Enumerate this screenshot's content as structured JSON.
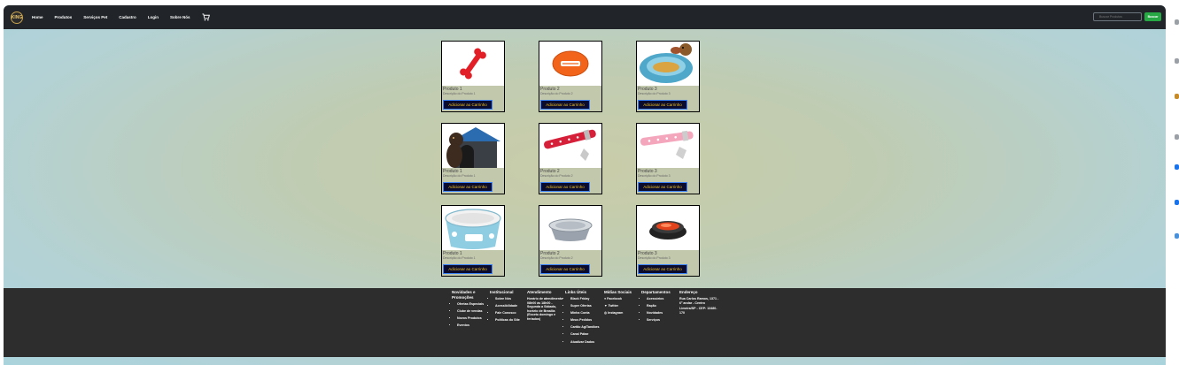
{
  "navbar": {
    "brand": "KING",
    "links": [
      "Home",
      "Produtos",
      "Serviços Pet",
      "Cadastro",
      "Login",
      "Sobre Nós"
    ],
    "search_placeholder": "Buscar Produtos",
    "search_button": "Buscar"
  },
  "products": [
    {
      "name": "Produto 1",
      "desc": "Descrição do Produto 1",
      "button": "Adicionar ao Carrinho",
      "image": "red-bone-toy"
    },
    {
      "name": "Produto 2",
      "desc": "Descrição do Produto 2",
      "button": "Adicionar ao Carrinho",
      "image": "orange-football-toy"
    },
    {
      "name": "Produto 3",
      "desc": "Descrição do Produto 3",
      "button": "Adicionar ao Carrinho",
      "image": "dog-feeder-bowl"
    },
    {
      "name": "Produto 1",
      "desc": "Descrição do Produto 1",
      "button": "Adicionar ao Carrinho",
      "image": "dog-house"
    },
    {
      "name": "Produto 2",
      "desc": "Descrição do Produto 2",
      "button": "Adicionar ao Carrinho",
      "image": "red-collar"
    },
    {
      "name": "Produto 3",
      "desc": "Descrição do Produto 3",
      "button": "Adicionar ao Carrinho",
      "image": "pink-collar"
    },
    {
      "name": "Produto 1",
      "desc": "Descrição do Produto 1",
      "button": "Adicionar ao Carrinho",
      "image": "blue-ceramic-bowl"
    },
    {
      "name": "Produto 2",
      "desc": "Descrição do Produto 2",
      "button": "Adicionar ao Carrinho",
      "image": "steel-bowl"
    },
    {
      "name": "Produto 3",
      "desc": "Descrição do Produto 3",
      "button": "Adicionar ao Carrinho",
      "image": "black-red-bowl"
    }
  ],
  "footer": {
    "novidades": {
      "title": "Novidades e Promoções",
      "items": [
        "Ofertas Especiais",
        "Clube de vendas",
        "Novos Produtos",
        "Eventos"
      ]
    },
    "institucional": {
      "title": "Institucional",
      "items": [
        "Sobre Nós",
        "Acessibilidade",
        "Fale Conosco",
        "Políticas do Site"
      ]
    },
    "atendimento": {
      "title": "Atendimento",
      "text": "Horário de atendimento 08h00 às 18h00 - Segunda a Sábado, horário de Brasília (Exceto domingo e feriados)"
    },
    "links": {
      "title": "Links Úteis",
      "items": [
        "Black Friday",
        "Super Ofertas",
        "Minha Conta",
        "Meus Pedidos",
        "Cartão AgiTandbes",
        "Canal Pátae",
        "Atualizar Dados"
      ]
    },
    "midias": {
      "title": "Mídias Sociais",
      "items": [
        "Facebook",
        "Twitter",
        "Instagram"
      ]
    },
    "departamentos": {
      "title": "Departamentos",
      "items": [
        "Acessórios",
        "Ração",
        "Novidades",
        "Serviços"
      ]
    },
    "endereco": {
      "title": "Endereço",
      "line1": "Rua Carlos Ramos, 1371 - 6° andar - Centro",
      "line2": "Limeira/SP - CEP: 13480-170"
    }
  },
  "colors": {
    "navbar": "#212529",
    "footer": "#2d2d2d",
    "button_bg": "#0b0b2e",
    "button_text": "#f5c518",
    "search_button": "#28a745"
  }
}
